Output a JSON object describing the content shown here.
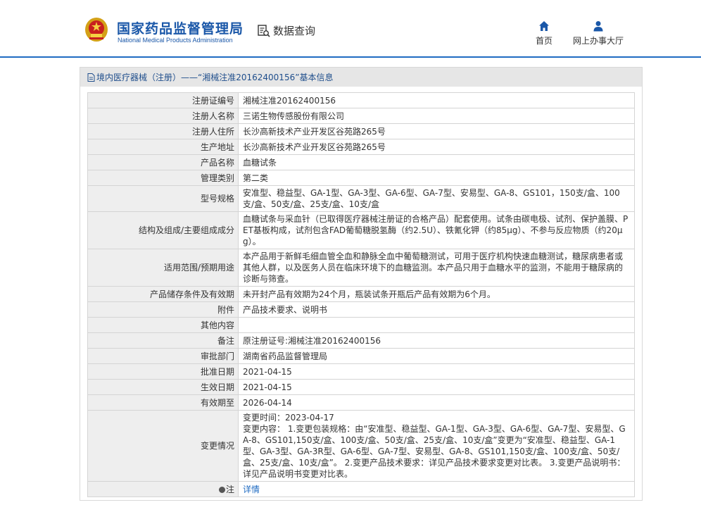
{
  "header": {
    "site_title": "国家药品监督管理局",
    "site_subtitle": "National Medical Products Administration",
    "search_label": "数据查询",
    "nav": [
      {
        "label": "首页",
        "icon": "home-icon"
      },
      {
        "label": "网上办事大厅",
        "icon": "user-icon"
      }
    ]
  },
  "panel": {
    "title_prefix": "境内医疗器械（注册）",
    "title_dash": " —— ",
    "title_quoted": "“湘械注准20162400156”",
    "title_suffix": "基本信息"
  },
  "rows": [
    {
      "key": "注册证编号",
      "value": "湘械注准20162400156"
    },
    {
      "key": "注册人名称",
      "value": "三诺生物传感股份有限公司"
    },
    {
      "key": "注册人住所",
      "value": "长沙高新技术产业开发区谷苑路265号"
    },
    {
      "key": "生产地址",
      "value": "长沙高新技术产业开发区谷苑路265号"
    },
    {
      "key": "产品名称",
      "value": "血糖试条"
    },
    {
      "key": "管理类别",
      "value": "第二类"
    },
    {
      "key": "型号规格",
      "value": "安准型、稳益型、GA-1型、GA-3型、GA-6型、GA-7型、安易型、GA-8、GS101，150支/盒、100支/盒、50支/盒、25支/盒、10支/盒"
    },
    {
      "key": "结构及组成/主要组成成分",
      "value": "血糖试条与采血针（已取得医疗器械注册证的合格产品）配套使用。试条由碳电极、试剂、保护盖膜、PET基板构成，试剂包含FAD葡萄糖脱氢酶（约2.5U）、铁氰化钾（约85μg）、不参与反应物质（约20μg）。"
    },
    {
      "key": "适用范围/预期用途",
      "value": "本产品用于新鲜毛细血管全血和静脉全血中葡萄糖测试，可用于医疗机构快速血糖测试，糖尿病患者或其他人群，以及医务人员在临床环境下的血糖监测。本产品只用于血糖水平的监测，不能用于糖尿病的诊断与筛查。"
    },
    {
      "key": "产品储存条件及有效期",
      "value": "未开封产品有效期为24个月，瓶装试条开瓶后产品有效期为6个月。"
    },
    {
      "key": "附件",
      "value": "产品技术要求、说明书"
    },
    {
      "key": "其他内容",
      "value": ""
    },
    {
      "key": "备注",
      "value": "原注册证号:湘械注准20162400156"
    },
    {
      "key": "审批部门",
      "value": "湖南省药品监督管理局"
    },
    {
      "key": "批准日期",
      "value": "2021-04-15"
    },
    {
      "key": "生效日期",
      "value": "2021-04-15"
    },
    {
      "key": "有效期至",
      "value": "2026-04-14"
    }
  ],
  "change": {
    "key": "变更情况",
    "time_line": "变更时间：2023-04-17",
    "content": "变更内容：  1.变更包装规格：由“安准型、稳益型、GA-1型、GA-3型、GA-6型、GA-7型、安易型、GA-8、GS101,150支/盒、100支/盒、50支/盒、25支/盒、10支/盒”变更为“安准型、稳益型、GA-1型、GA-3型、GA-3R型、GA-6型、GA-7型、安易型、GA-8、GS101,150支/盒、100支/盒、50支/盒、25支/盒、10支/盒”。 2.变更产品技术要求：详见产品技术要求变更对比表。 3.变更产品说明书：详见产品说明书变更对比表。"
  },
  "note": {
    "key": "注",
    "link_label": "详情"
  },
  "colors": {
    "brand_blue": "#1a57a8",
    "header_rule": "#1f6bc2",
    "link": "#1f6bc2",
    "key_bg": "#eeeeee"
  }
}
